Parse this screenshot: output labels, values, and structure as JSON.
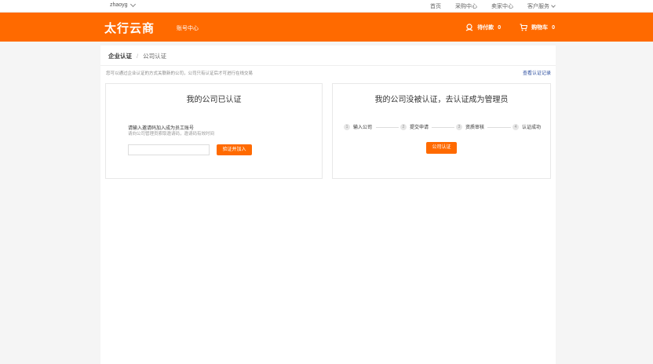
{
  "topbar": {
    "username": "zhaoyg",
    "links": [
      "首页",
      "采购中心",
      "卖家中心",
      "客户服务"
    ]
  },
  "header": {
    "logo": "太行云商",
    "nav_label": "账号中心",
    "pending_payment": "待付款",
    "pending_count": "0",
    "cart": "购物车",
    "cart_count": "0"
  },
  "breadcrumb": {
    "level1": "企业认证",
    "separator": "/",
    "level2": "公司认证"
  },
  "hint_text": "您可以通过企业认证的方式关联新的公司，公司只有认证后才可进行在线交易",
  "records_link": "查看认证记录",
  "left_card": {
    "title": "我的公司已认证",
    "join_title": "请输入邀请码加入成为员工账号",
    "join_subtitle": "请向公司管理员索取邀请码，邀请码有效时间",
    "code_value": "",
    "join_button": "验证并加入"
  },
  "right_card": {
    "title": "我的公司没被认证，去认证成为管理员",
    "steps": [
      {
        "num": "1",
        "label": "输入公司"
      },
      {
        "num": "2",
        "label": "提交申请"
      },
      {
        "num": "3",
        "label": "资质审核"
      },
      {
        "num": "4",
        "label": "认证成功"
      }
    ],
    "cert_button": "公司认证"
  },
  "colors": {
    "brand": "#ff6a00",
    "link": "#2d4fa0"
  }
}
